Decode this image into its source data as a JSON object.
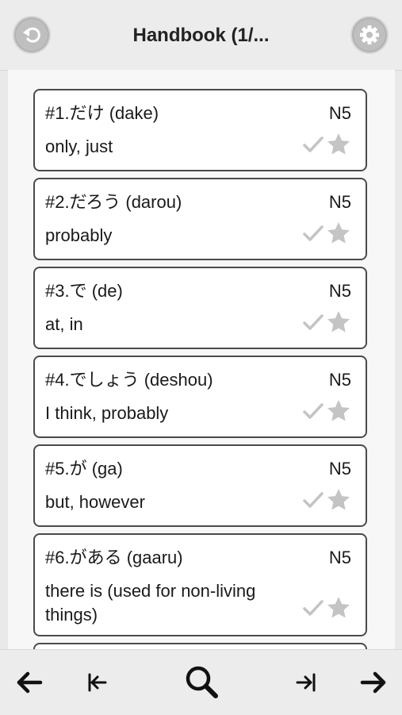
{
  "header": {
    "title": "Handbook (1/...",
    "back_icon": "back-arrow-icon",
    "settings_icon": "gear-icon"
  },
  "cards": [
    {
      "heading": "#1.だけ (dake)",
      "level": "N5",
      "meaning": "only, just"
    },
    {
      "heading": "#2.だろう (darou)",
      "level": "N5",
      "meaning": "probably"
    },
    {
      "heading": "#3.で (de)",
      "level": "N5",
      "meaning": "at, in"
    },
    {
      "heading": "#4.でしょう (deshou)",
      "level": "N5",
      "meaning": "I think, probably"
    },
    {
      "heading": "#5.が (ga)",
      "level": "N5",
      "meaning": "but, however"
    },
    {
      "heading": "#6.がある (gaaru)",
      "level": "N5",
      "meaning": "there is (used for non-living things)"
    }
  ],
  "footer": {
    "icons": [
      "arrow-left-icon",
      "first-page-icon",
      "search-icon",
      "last-page-icon",
      "arrow-right-icon"
    ]
  },
  "colors": {
    "card_border": "#4a4a4a",
    "icon_gray": "#c4c4c4",
    "header_bg": "#ececec"
  }
}
